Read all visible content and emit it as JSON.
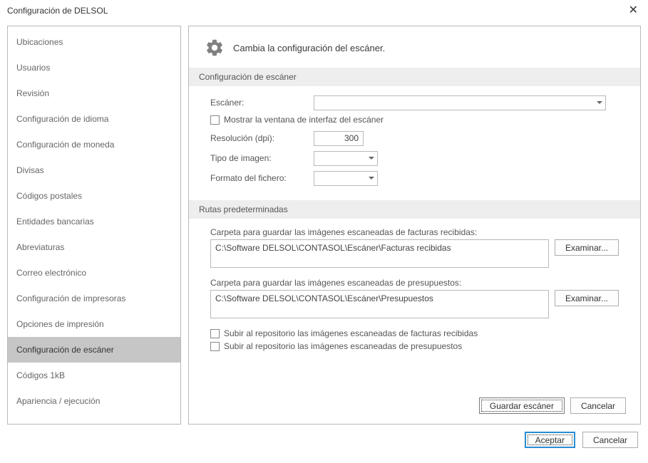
{
  "window": {
    "title": "Configuración de DELSOL"
  },
  "sidebar": {
    "items": [
      "Ubicaciones",
      "Usuarios",
      "Revisión",
      "Configuración de idioma",
      "Configuración de moneda",
      "Divisas",
      "Códigos postales",
      "Entidades bancarias",
      "Abreviaturas",
      "Correo electrónico",
      "Configuración de impresoras",
      "Opciones de impresión",
      "Configuración de escáner",
      "Códigos 1kB",
      "Apariencia / ejecución"
    ],
    "selectedIndex": 12
  },
  "main": {
    "headerText": "Cambia la configuración del escáner.",
    "section1": {
      "title": "Configuración de escáner",
      "scannerLabel": "Escáner:",
      "showInterfaceCheckbox": "Mostrar la ventana de interfaz del escáner",
      "resolutionLabel": "Resolución (dpi):",
      "resolutionValue": "300",
      "imageTypeLabel": "Tipo de imagen:",
      "fileFormatLabel": "Formato del fichero:"
    },
    "section2": {
      "title": "Rutas predeterminadas",
      "invoicesLabel": "Carpeta para guardar las imágenes escaneadas de facturas recibidas:",
      "invoicesPath": "C:\\Software DELSOL\\CONTASOL\\Escáner\\Facturas recibidas",
      "quotesLabel": "Carpeta para guardar las imágenes escaneadas de presupuestos:",
      "quotesPath": "C:\\Software DELSOL\\CONTASOL\\Escáner\\Presupuestos",
      "browseButton": "Examinar...",
      "uploadInvoices": "Subir al repositorio las imágenes escaneadas de facturas recibidas",
      "uploadQuotes": "Subir al repositorio las imágenes escaneadas de presupuestos"
    },
    "panelButtons": {
      "save": "Guardar escáner",
      "cancel": "Cancelar"
    }
  },
  "dialogButtons": {
    "accept": "Aceptar",
    "cancel": "Cancelar"
  }
}
